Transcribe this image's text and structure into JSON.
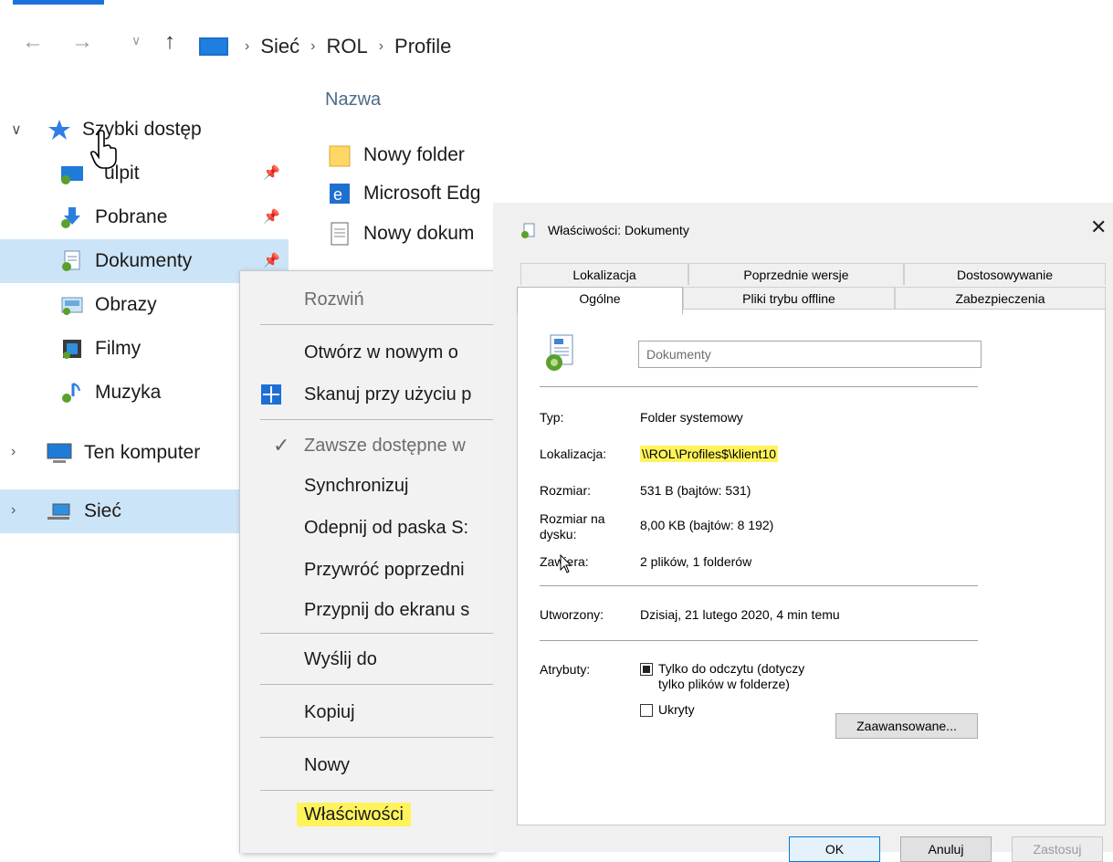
{
  "explorer": {
    "address": [
      "Sieć",
      "ROL",
      "Profile"
    ],
    "column_header": "Nazwa",
    "nav": [
      {
        "label": "Szybki dostęp",
        "icon": "star-icon"
      },
      {
        "label": "ulpit",
        "icon": "desktop-icon"
      },
      {
        "label": "Pobrane",
        "icon": "download-icon"
      },
      {
        "label": "Dokumenty",
        "icon": "documents-icon"
      },
      {
        "label": "Obrazy",
        "icon": "pictures-icon"
      },
      {
        "label": "Filmy",
        "icon": "videos-icon"
      },
      {
        "label": "Muzyka",
        "icon": "music-icon"
      },
      {
        "label": "Ten komputer",
        "icon": "computer-icon"
      },
      {
        "label": "Sieć",
        "icon": "network-icon"
      }
    ],
    "files": [
      {
        "name": "Nowy folder",
        "icon": "folder-icon"
      },
      {
        "name": "Microsoft Edg",
        "icon": "edge-icon"
      },
      {
        "name": "Nowy dokum",
        "icon": "text-document-icon"
      }
    ]
  },
  "context_menu": {
    "items": [
      {
        "label": "Rozwiń",
        "disabled": true
      },
      {
        "label": "Otwórz w nowym o"
      },
      {
        "label": "Skanuj przy użyciu p",
        "icon": "defender-shield-icon"
      },
      {
        "label": "Zawsze dostępne w",
        "disabled": true,
        "checked": true
      },
      {
        "label": "Synchronizuj"
      },
      {
        "label": "Odepnij od paska S:"
      },
      {
        "label": "Przywróć poprzedni"
      },
      {
        "label": "Przypnij do ekranu s"
      },
      {
        "label": "Wyślij do"
      },
      {
        "label": "Kopiuj"
      },
      {
        "label": "Nowy"
      },
      {
        "label": "Właściwości",
        "highlighted": true
      }
    ]
  },
  "dialog": {
    "title": "Właściwości: Dokumenty",
    "tabs_row1": [
      "Lokalizacja",
      "Poprzednie wersje",
      "Dostosowywanie"
    ],
    "tabs_row2": [
      "Ogólne",
      "Pliki trybu offline",
      "Zabezpieczenia"
    ],
    "active_tab": "Ogólne",
    "name_value": "Dokumenty",
    "fields": {
      "type_label": "Typ:",
      "type_value": "Folder systemowy",
      "location_label": "Lokalizacja:",
      "location_value": "\\\\ROL\\Profiles$\\klient10",
      "size_label": "Rozmiar:",
      "size_value": "531 B (bajtów: 531)",
      "disk_label_1": "Rozmiar na",
      "disk_label_2": "dysku:",
      "disk_value": "8,00 KB (bajtów: 8 192)",
      "contains_label": "Zawiera:",
      "contains_value": "2 plików, 1 folderów",
      "created_label": "Utworzony:",
      "created_value": "Dzisiaj, 21 lutego 2020, 4 min temu",
      "attributes_label": "Atrybuty:",
      "readonly_line1": "Tylko do odczytu (dotyczy",
      "readonly_line2": "tylko plików w folderze)",
      "hidden_label": "Ukryty",
      "advanced_button": "Zaawansowane..."
    },
    "buttons": {
      "ok": "OK",
      "cancel": "Anuluj",
      "apply": "Zastosuj"
    }
  }
}
